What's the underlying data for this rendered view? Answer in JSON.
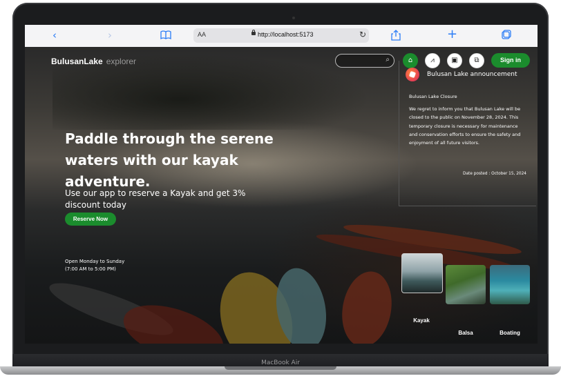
{
  "browser": {
    "text_size_label": "AA",
    "url": "http://localhost:5173",
    "back_icon": "chevron-left-icon",
    "forward_icon": "chevron-right-icon",
    "bookmarks_icon": "book-icon",
    "reload_icon": "reload-icon",
    "share_icon": "share-icon",
    "new_tab_icon": "plus-icon",
    "tabs_icon": "tabs-icon"
  },
  "header": {
    "brand_name": "BulusanLake",
    "brand_sub": "explorer",
    "search_placeholder": "",
    "nav_icons": [
      "home-icon",
      "hiking-icon",
      "gallery-icon",
      "booking-icon"
    ],
    "sign_in_label": "Sign in"
  },
  "hero": {
    "title": "Paddle through the serene waters with our kayak adventure.",
    "subtitle": "Use our app to reserve a Kayak and get 3% discount today",
    "cta_label": "Reserve Now",
    "hours_line1": "Open Monday to Sunday",
    "hours_line2": "(7:00 AM to 5:00 PM)"
  },
  "announcement": {
    "heading": "Bulusan Lake announcement",
    "title": "Bulusan Lake Closure",
    "body": "We regret to inform you that Bulusan Lake will be closed to the public on November 28, 2024. This temporary closure is necessary for maintenance and conservation efforts to ensure the safety and enjoyment of all future visitors.",
    "date": "Date posted : October 15, 2024"
  },
  "activities": [
    {
      "label": "Kayak"
    },
    {
      "label": "Balsa"
    },
    {
      "label": "Boating"
    }
  ],
  "device": {
    "model": "MacBook Air"
  },
  "colors": {
    "accent_green": "#1b8c2d",
    "safari_blue": "#2a7cf6"
  }
}
